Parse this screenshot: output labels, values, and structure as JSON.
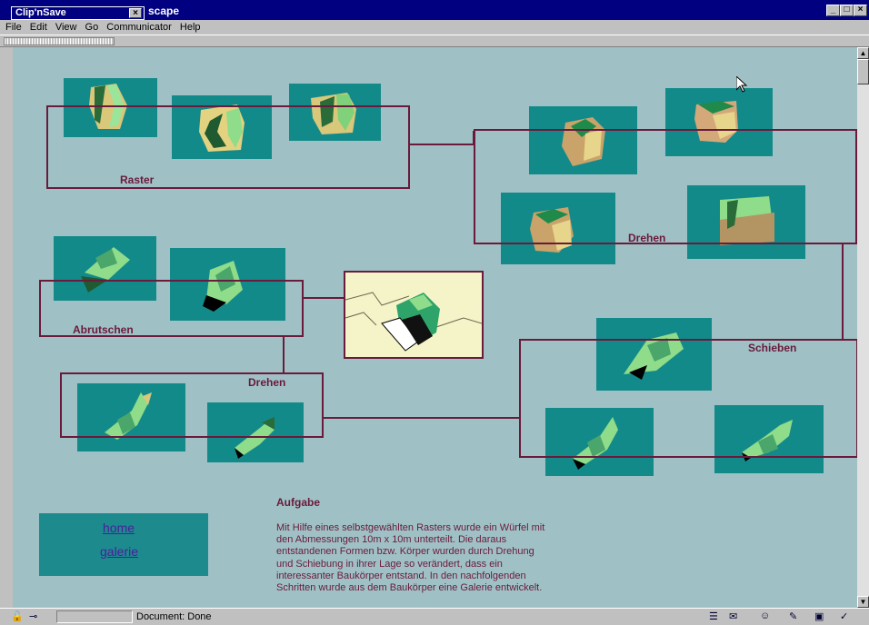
{
  "window": {
    "clip_title": "Clip'nSave",
    "clip_close": "×",
    "title_suffix": "scape",
    "controls": [
      "_",
      "□",
      "×"
    ]
  },
  "menu": [
    "File",
    "Edit",
    "View",
    "Go",
    "Communicator",
    "Help"
  ],
  "diagram": {
    "groups": [
      {
        "label": "Raster"
      },
      {
        "label": "Drehen"
      },
      {
        "label": "Abrutschen"
      },
      {
        "label": "Drehen"
      },
      {
        "label": "Schieben"
      }
    ]
  },
  "nav": {
    "home": "home",
    "galerie": "galerie"
  },
  "task": {
    "title": "Aufgabe",
    "lines": [
      "Mit Hilfe eines selbstgewählten Rasters wurde ein Würfel mit",
      "den Abmessungen 10m x 10m unterteilt. Die daraus",
      "entstandenen Formen bzw. Körper wurden durch Drehung",
      "und Schiebung in ihrer Lage so verändert, dass ein",
      "interessanter Baukörper entstand. In den nachfolgenden",
      "Schritten wurde aus dem Baukörper eine Galerie entwickelt."
    ]
  },
  "status": {
    "text": "Document: Done"
  },
  "colors": {
    "page_bg": "#9fc1c6",
    "tile": "#138a8a",
    "frame": "#6a1a3a",
    "titlebar": "#000080"
  }
}
